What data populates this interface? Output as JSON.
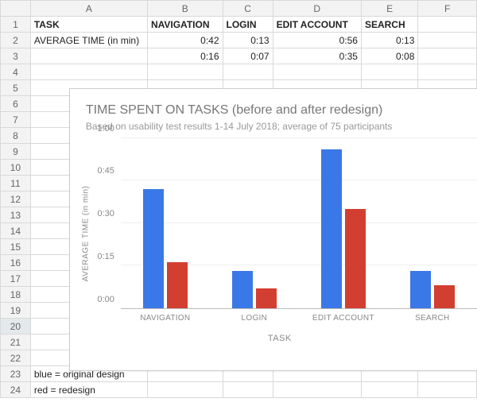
{
  "columns": [
    "",
    "A",
    "B",
    "C",
    "D",
    "E",
    "F"
  ],
  "rows": [
    {
      "n": "1",
      "cells": [
        "TASK",
        "NAVIGATION",
        "LOGIN",
        "EDIT ACCOUNT",
        "SEARCH",
        ""
      ],
      "bold": true
    },
    {
      "n": "2",
      "cells": [
        "AVERAGE TIME (in min)",
        "0:42",
        "0:13",
        "0:56",
        "0:13",
        ""
      ]
    },
    {
      "n": "3",
      "cells": [
        "",
        "0:16",
        "0:07",
        "0:35",
        "0:08",
        ""
      ]
    },
    {
      "n": "4",
      "cells": [
        "",
        "",
        "",
        "",
        "",
        ""
      ]
    }
  ],
  "chart_rows_start": 5,
  "chart_rows_end": 22,
  "footer_rows": [
    {
      "n": "23",
      "text": "blue = original design"
    },
    {
      "n": "24",
      "text": "red = redesign"
    }
  ],
  "chart_data": {
    "type": "bar",
    "title": "TIME SPENT ON TASKS (before and after redesign)",
    "subtitle": "Based on usability test results 1-14 July 2018; average of 75 participants",
    "xlabel": "TASK",
    "ylabel": "AVERAGE TIME (in min)",
    "categories": [
      "NAVIGATION",
      "LOGIN",
      "EDIT ACCOUNT",
      "SEARCH"
    ],
    "series": [
      {
        "name": "original design",
        "color": "#3b78e7",
        "values": [
          42,
          13,
          56,
          13
        ]
      },
      {
        "name": "redesign",
        "color": "#d23f31",
        "values": [
          16,
          7,
          35,
          8
        ]
      }
    ],
    "y_ticks": [
      0,
      15,
      30,
      45,
      60
    ],
    "y_tick_labels": [
      "0:00",
      "0:15",
      "0:30",
      "0:45",
      "1:00"
    ],
    "ymax": 60
  }
}
